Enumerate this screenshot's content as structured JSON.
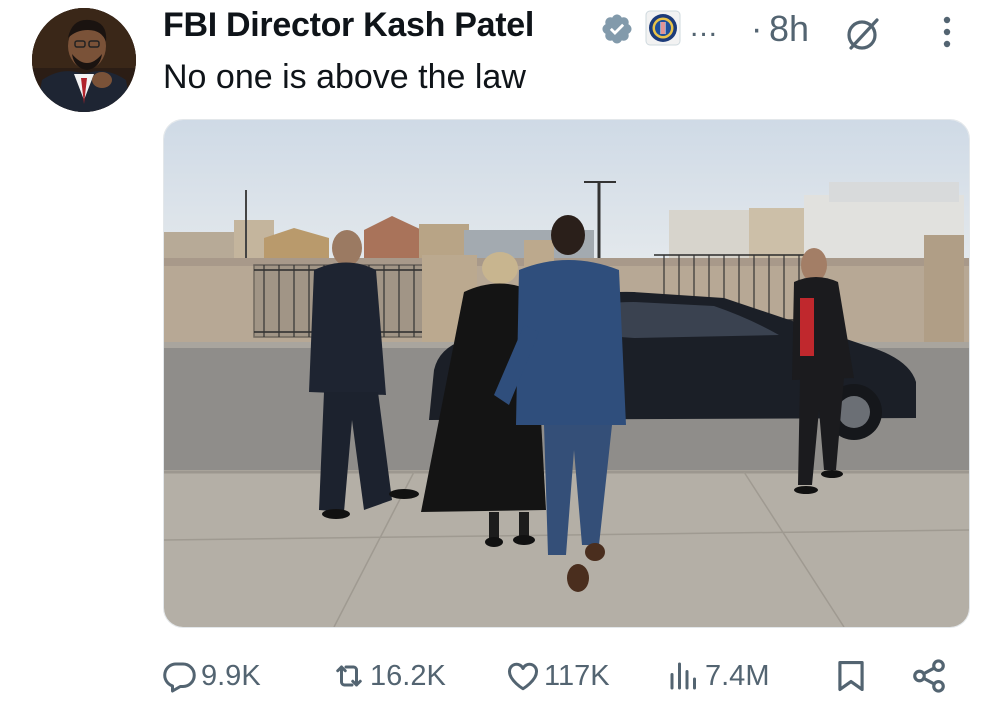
{
  "post": {
    "author_name": "FBI Director Kash Patel",
    "truncation": "...",
    "separator": "·",
    "time": "8h",
    "text": "No one is above the law"
  },
  "icons": {
    "verified": "verified-badge-icon",
    "affiliation": "fbi-seal-icon",
    "grok": "grok-icon",
    "more": "more-vertical-icon"
  },
  "actions": {
    "replies": "9.9K",
    "reposts": "16.2K",
    "likes": "117K",
    "views": "7.4M"
  },
  "colors": {
    "text_primary": "#0f1419",
    "text_secondary": "#536471",
    "verified_badge": "#829aab"
  }
}
